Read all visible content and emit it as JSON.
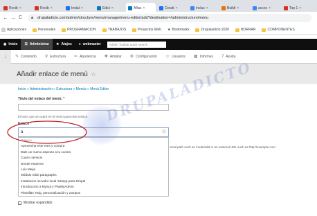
{
  "browser": {
    "tabs": [
      {
        "label": "Recib",
        "color": "#d93025",
        "active": false
      },
      {
        "label": "Recib",
        "color": "#d93025",
        "active": false
      },
      {
        "label": "Instal",
        "color": "#1a73e8",
        "active": false
      },
      {
        "label": "Edici",
        "color": "#0678be",
        "active": false
      },
      {
        "label": "Añac",
        "color": "#0678be",
        "active": true
      },
      {
        "label": "Creati",
        "color": "#1a73e8",
        "active": false
      },
      {
        "label": "incluc",
        "color": "#4285f4",
        "active": false
      },
      {
        "label": "Buildi",
        "color": "#e8710a",
        "active": false
      },
      {
        "label": "acces",
        "color": "#4285f4",
        "active": false
      },
      {
        "label": "Top 1",
        "color": "#d93025",
        "active": false
      }
    ],
    "back": "←",
    "forward": "→",
    "reload": "C",
    "url": "drupaladicto.com/admin/structure/menu/manage/menu-editor/add?destination=/admin/structure/menu"
  },
  "bookmarks": [
    {
      "label": "Aplicaciones",
      "type": "apps"
    },
    {
      "label": "Personales",
      "type": "folder"
    },
    {
      "label": "PROGRAMACION",
      "type": "folder"
    },
    {
      "label": "TRABAJOS",
      "type": "folder"
    },
    {
      "label": "Proyectos Web",
      "type": "folder"
    },
    {
      "label": "Bookmarks",
      "type": "star"
    },
    {
      "label": "Drupaladicto 2020",
      "type": "folder"
    },
    {
      "label": "BORRAR",
      "type": "folder"
    },
    {
      "label": "COMPONENTES",
      "type": "folder"
    }
  ],
  "admin_toolbar": {
    "inicio": "Inicio",
    "administrar": "Administrar",
    "atajos": "Atajos",
    "user": "webmaster",
    "search_placeholder": "Admin Toolbar quick search"
  },
  "tray": [
    {
      "label": "Contenido",
      "icon": "✎"
    },
    {
      "label": "Estructura",
      "icon": "⚲"
    },
    {
      "label": "Apariencia",
      "icon": "✂"
    },
    {
      "label": "Ampliar",
      "icon": "✚"
    },
    {
      "label": "Configuración",
      "icon": "⚙"
    },
    {
      "label": "Usuarios",
      "icon": "☺"
    },
    {
      "label": "Informes",
      "icon": "▦"
    },
    {
      "label": "Ayuda",
      "icon": "?"
    }
  ],
  "page": {
    "title": "Añadir enlace de menú",
    "star": "☆",
    "breadcrumb": "Inicio » Administración » Estructura » Menús » Menú Editor",
    "title_label": "Título del enlace del menú.",
    "required_mark": "*",
    "title_desc": "El texto que se usará en el menú para este enlace.",
    "link_label": "Enlace",
    "link_value": "a",
    "link_desc_partial": "ernal path such as /node/add or an external URL such as http://example.com",
    "autocomplete": [
      "Galaxia",
      "Aprovecha este mes y compra",
      "Dale un nuevo aspecto a tu cocina",
      "Cuarto servicio",
      "Donde estamos",
      "Luis Mejia",
      "Módulo Slick paragraphs",
      "Instalacion servidor local Xampp para Drupal",
      "Introducción a MySql y PhpMyAdmin",
      "Plantillas Twig, personalización y campos"
    ],
    "show_expanded": "Mostrar expandido"
  },
  "watermark": "DRUPALADICTO",
  "colors": {
    "link": "#0074bd",
    "admin_bg": "#0f0f0f",
    "header_bg": "#e9e9e9",
    "required": "#e00000",
    "ellipse": "#c0272d"
  }
}
